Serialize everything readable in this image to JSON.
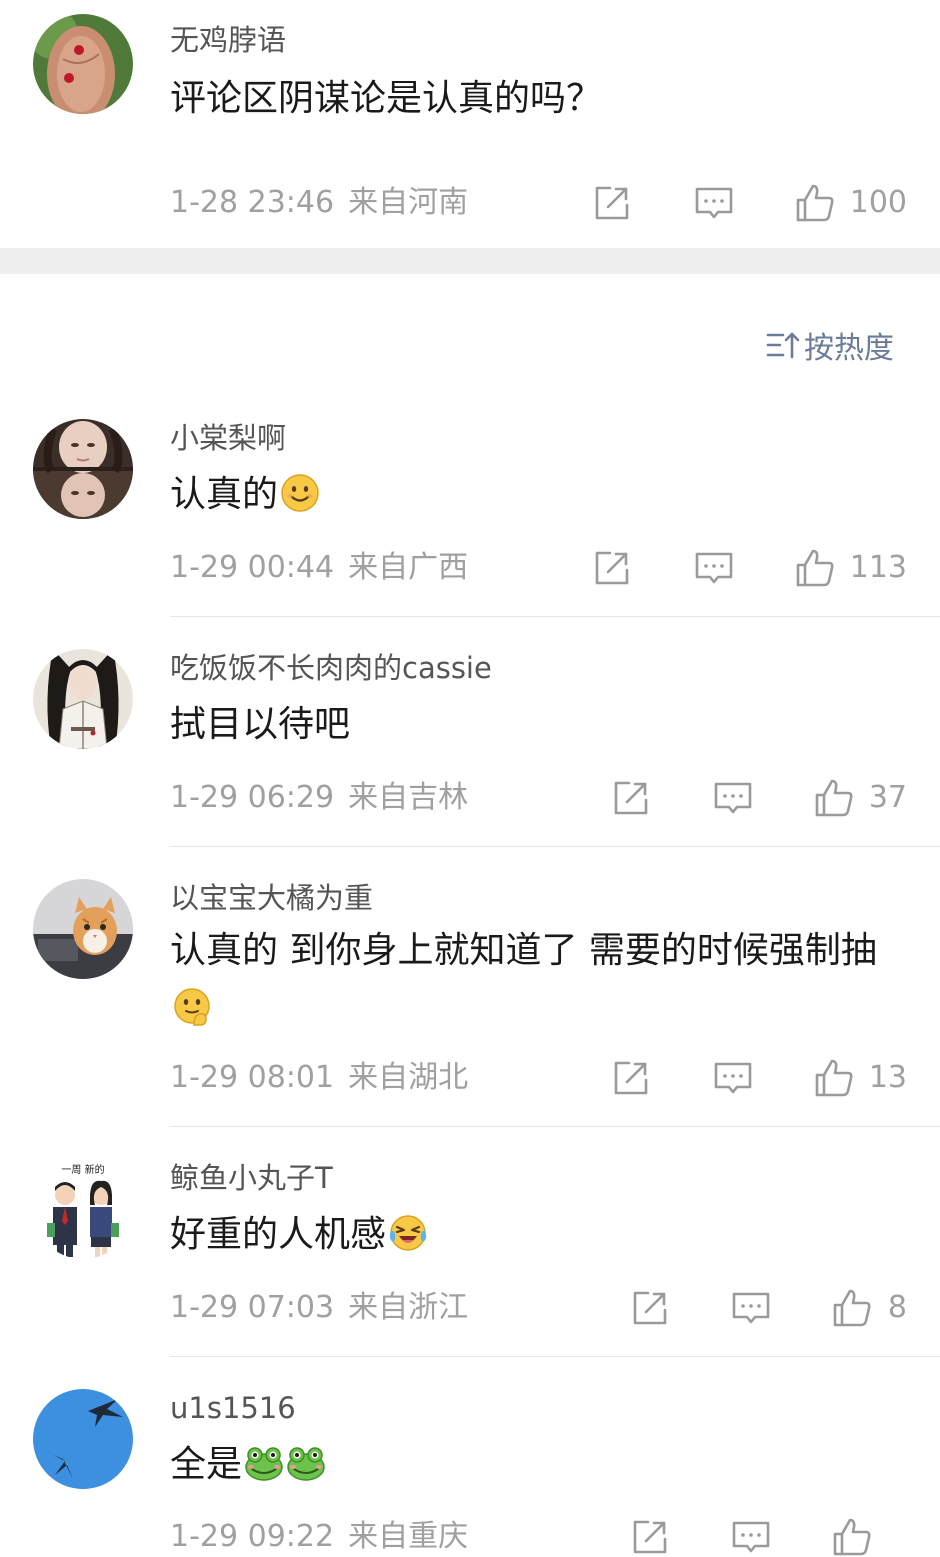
{
  "post": {
    "username": "无鸡脖语",
    "content": "评论区阴谋论是认真的吗？",
    "time": "1-28 23:46",
    "location": "来自河南",
    "likes": "100"
  },
  "sort": {
    "label": "按热度"
  },
  "comments": [
    {
      "username": "小棠梨啊",
      "text": "认真的",
      "emojis": [
        "smile-emoji"
      ],
      "time": "1-29 00:44",
      "location": "来自广西",
      "likes": "113"
    },
    {
      "username": "吃饭饭不长肉肉的cassie",
      "text": "拭目以待吧",
      "emojis": [],
      "time": "1-29 06:29",
      "location": "来自吉林",
      "likes": "37"
    },
    {
      "username": "以宝宝大橘为重",
      "text": "认真的 到你身上就知道了 需要的时候强制抽",
      "emojis": [
        "thinking-emoji"
      ],
      "time": "1-29 08:01",
      "location": "来自湖北",
      "likes": "13"
    },
    {
      "username": "鲸鱼小丸子T",
      "text": "好重的人机感",
      "emojis": [
        "laugh-cry-emoji"
      ],
      "time": "1-29 07:03",
      "location": "来自浙江",
      "likes": "8"
    },
    {
      "username": "u1s1516",
      "text": "全是",
      "emojis": [
        "frog-emoji",
        "frog-emoji"
      ],
      "time": "1-29 09:22",
      "location": "来自重庆",
      "likes": ""
    }
  ],
  "colors": {
    "meta_gray": "#a0a0a0",
    "username_gray": "#555555",
    "sort_blue": "#6a7c99",
    "section_gap": "#eeeeee"
  }
}
